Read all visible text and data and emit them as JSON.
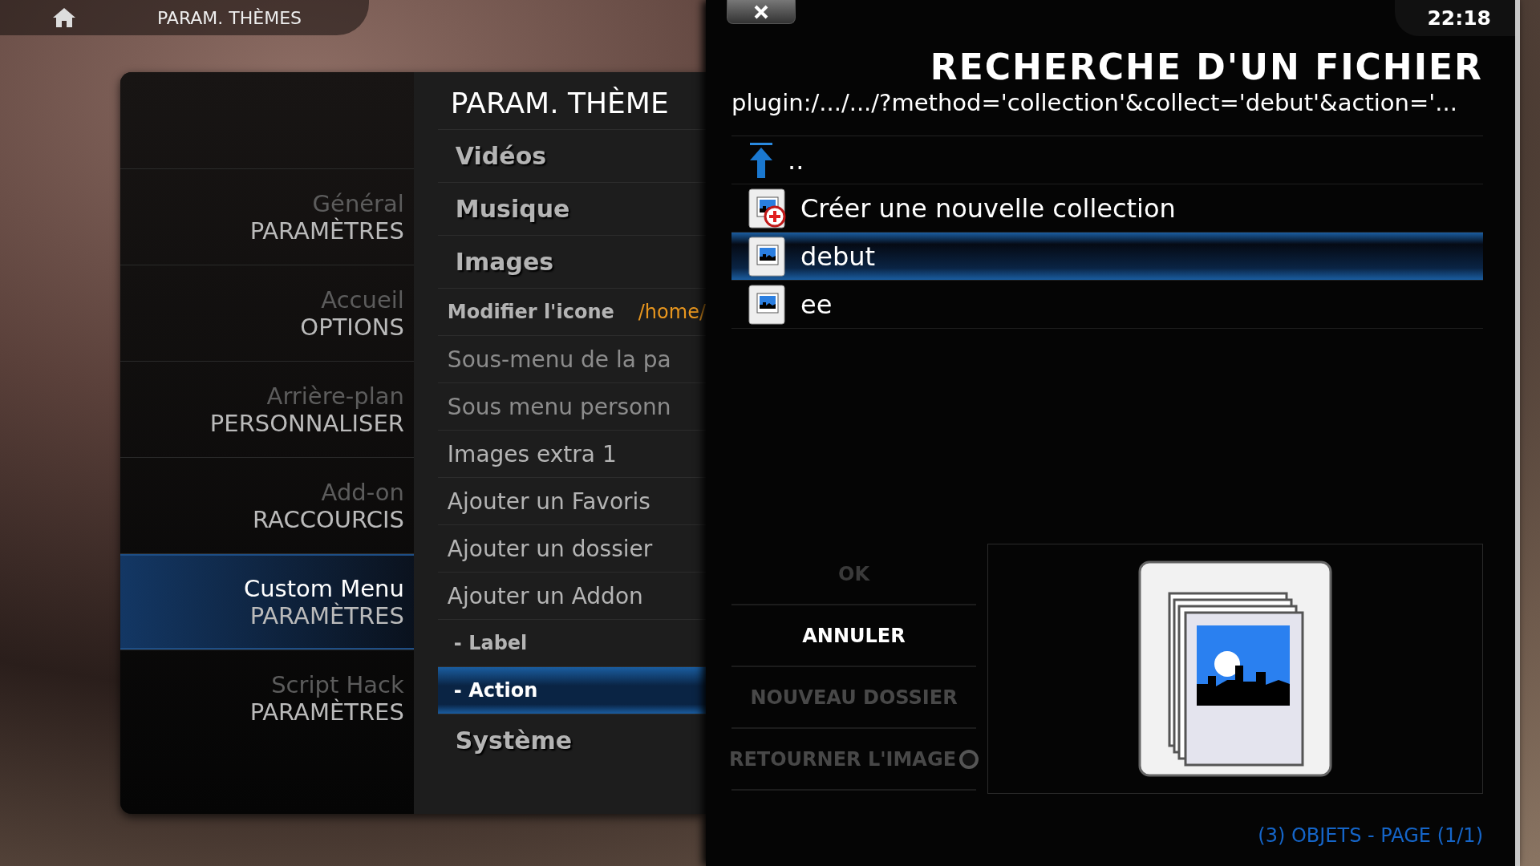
{
  "top_bar": {
    "title": "PARAM. THÈMES"
  },
  "settings_panel": {
    "title": "PARAM. THÈME",
    "categories": [
      {
        "label": "Général",
        "sublabel": "PARAMÈTRES",
        "selected": false
      },
      {
        "label": "Accueil",
        "sublabel": "OPTIONS",
        "selected": false
      },
      {
        "label": "Arrière-plan",
        "sublabel": "PERSONNALISER",
        "selected": false
      },
      {
        "label": "Add-on",
        "sublabel": "RACCOURCIS",
        "selected": false
      },
      {
        "label": "Custom Menu",
        "sublabel": "PARAMÈTRES",
        "selected": true
      },
      {
        "label": "Script Hack",
        "sublabel": "PARAMÈTRES",
        "selected": false
      }
    ],
    "items": [
      {
        "kind": "section",
        "label": "Vidéos",
        "selected": false,
        "disabled": false
      },
      {
        "kind": "section",
        "label": "Musique",
        "selected": false,
        "disabled": false
      },
      {
        "kind": "section",
        "label": "Images",
        "selected": false,
        "disabled": false
      },
      {
        "kind": "setting",
        "label": "Modifier l'icone",
        "value": "/home/",
        "selected": false,
        "disabled": false
      },
      {
        "kind": "item",
        "label": "Sous-menu de la pa",
        "selected": false,
        "disabled": true
      },
      {
        "kind": "item",
        "label": "Sous menu personn",
        "selected": false,
        "disabled": true
      },
      {
        "kind": "item",
        "label": "Images extra 1",
        "selected": false,
        "disabled": false
      },
      {
        "kind": "item",
        "label": "Ajouter un Favoris",
        "selected": false,
        "disabled": false
      },
      {
        "kind": "item",
        "label": "Ajouter un dossier",
        "selected": false,
        "disabled": false
      },
      {
        "kind": "item",
        "label": "Ajouter un Addon",
        "selected": false,
        "disabled": false
      },
      {
        "kind": "subitem",
        "label": "- Label",
        "selected": false,
        "disabled": false
      },
      {
        "kind": "subitem",
        "label": "- Action",
        "selected": true,
        "disabled": false
      },
      {
        "kind": "section",
        "label": "Système",
        "selected": false,
        "disabled": false
      }
    ]
  },
  "dialog": {
    "clock": "22:18",
    "title": "RECHERCHE D'UN FICHIER",
    "path": "plugin:/.../.../?method='collection'&collect='debut'&action='...",
    "files": [
      {
        "kind": "parent",
        "label": "..",
        "selected": false
      },
      {
        "kind": "new",
        "label": "Créer une nouvelle collection",
        "selected": false
      },
      {
        "kind": "image",
        "label": "debut",
        "selected": true
      },
      {
        "kind": "image",
        "label": "ee",
        "selected": false
      }
    ],
    "buttons": [
      {
        "kind": "button",
        "label": "OK",
        "selected": false,
        "disabled": true
      },
      {
        "kind": "button",
        "label": "ANNULER",
        "selected": true,
        "disabled": false
      },
      {
        "kind": "button",
        "label": "NOUVEAU DOSSIER",
        "selected": false,
        "disabled": false
      },
      {
        "kind": "toggle",
        "label": "RETOURNER L'IMAGE",
        "selected": false,
        "disabled": false,
        "on": false
      }
    ],
    "footer": "(3) OBJETS - PAGE (1/1)"
  }
}
